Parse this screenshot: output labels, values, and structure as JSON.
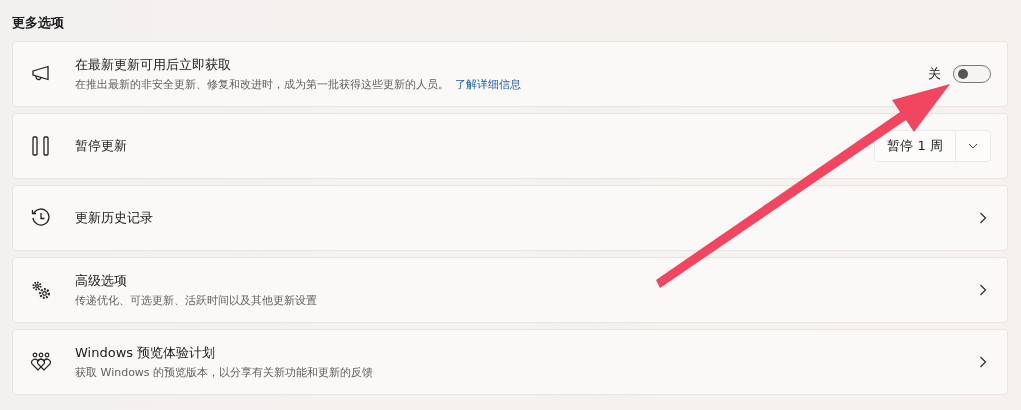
{
  "section_title": "更多选项",
  "items": [
    {
      "kind": "toggle",
      "title": "在最新更新可用后立即获取",
      "description": "在推出最新的非安全更新、修复和改进时，成为第一批获得这些更新的人员。",
      "link": "了解详细信息",
      "state_label": "关",
      "on": false
    },
    {
      "kind": "dropdown",
      "title": "暂停更新",
      "value": "暂停 1 周"
    },
    {
      "kind": "nav",
      "title": "更新历史记录"
    },
    {
      "kind": "nav",
      "title": "高级选项",
      "description": "传递优化、可选更新、活跃时间以及其他更新设置"
    },
    {
      "kind": "nav",
      "title": "Windows 预览体验计划",
      "description": "获取 Windows 的预览版本，以分享有关新功能和更新的反馈"
    }
  ]
}
